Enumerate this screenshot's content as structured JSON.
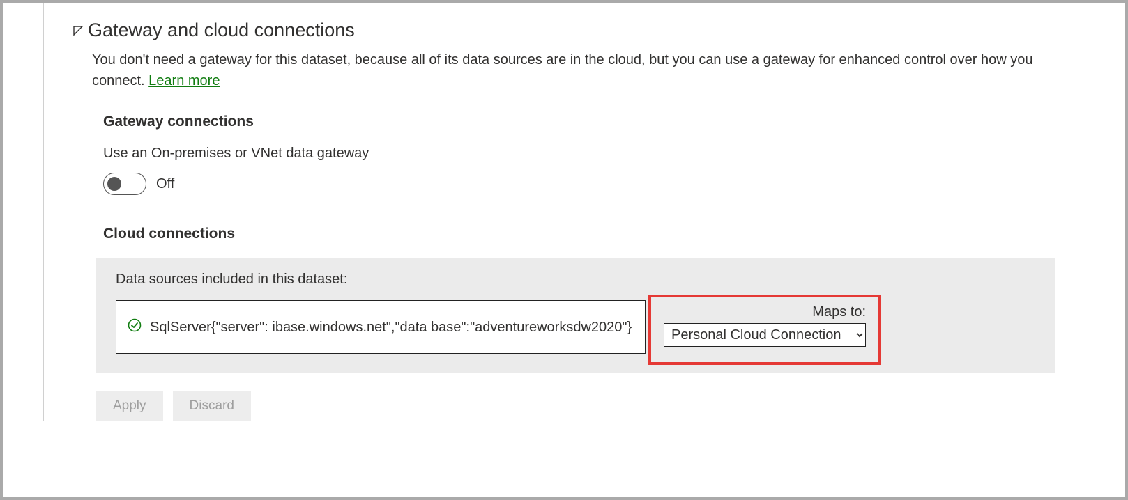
{
  "section": {
    "title": "Gateway and cloud connections",
    "description_pre": "You don't need a gateway for this dataset, because all of its data sources are in the cloud, but you can use a gateway for enhanced control over how you connect. ",
    "learn_more": "Learn more"
  },
  "gateway": {
    "heading": "Gateway connections",
    "label": "Use an On-premises or VNet data gateway",
    "toggle_state": "Off"
  },
  "cloud": {
    "heading": "Cloud connections",
    "panel_title": "Data sources included in this dataset:",
    "datasource_text": "SqlServer{\"server\":             ibase.windows.net\",\"data base\":\"adventureworksdw2020\"}",
    "maps_label": "Maps to:",
    "maps_selected": "Personal Cloud Connection"
  },
  "buttons": {
    "apply": "Apply",
    "discard": "Discard"
  }
}
